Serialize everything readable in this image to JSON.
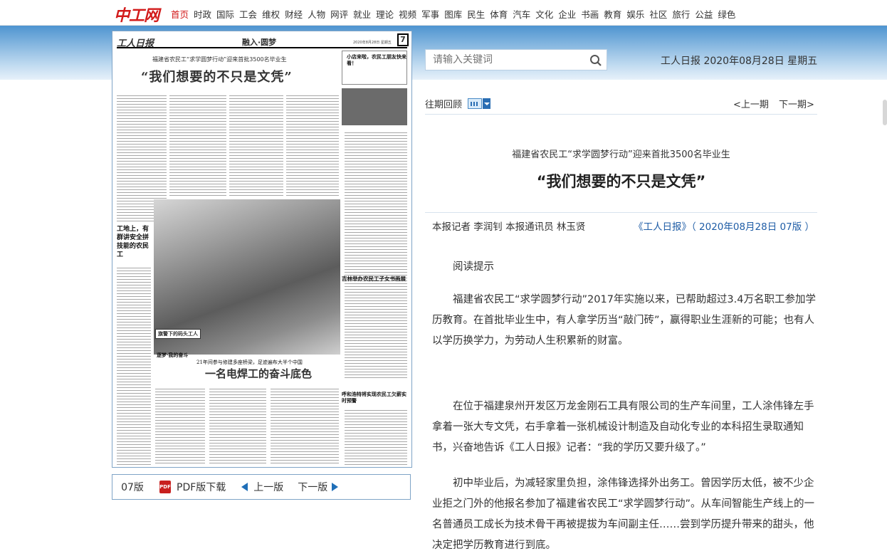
{
  "site": {
    "logo": "中工网",
    "nav": [
      "首页",
      "时政",
      "国际",
      "工会",
      "维权",
      "财经",
      "人物",
      "网评",
      "就业",
      "理论",
      "视频",
      "军事",
      "图库",
      "民生",
      "体育",
      "汽车",
      "文化",
      "企业",
      "书画",
      "教育",
      "娱乐",
      "社区",
      "旅行",
      "公益",
      "绿色"
    ],
    "active_nav": "首页"
  },
  "paper": {
    "logo": "工人日报",
    "section": "融入·圆梦",
    "page_no": "7",
    "date": "2020年8月28日 星期五",
    "subtitle": "福建省农民工“求学圆梦行动”迎来首批3500名毕业生",
    "headline": "“我们想要的不只是文凭”",
    "box_title": "小店来啦，农民工朋友快来看！",
    "side_head_1": "工地上，有群讲安全拼技能的农民工",
    "side_head_2": "吉林举办农民工子女书画展",
    "side_head_3": "呼和浩特将实现农民工欠薪实时预警",
    "photo_caption": "旗警下的码头工人",
    "lower_kicker": "21年间参与修建多座桥梁，足迹遍布大半个中国",
    "lower_headline": "一名电焊工的奋斗底色",
    "lower_tag": "逐梦·我的奋斗"
  },
  "pager": {
    "page_label": "07版",
    "pdf_label": "PDF版下载",
    "prev_label": "上一版",
    "next_label": "下一版"
  },
  "search": {
    "placeholder": "请输入关键词"
  },
  "header_date": "工人日报 2020年08月28日 星期五",
  "archive": {
    "label": "往期回顾",
    "prev": "<上一期",
    "next": "下一期>"
  },
  "article": {
    "subtitle": "福建省农民工“求学圆梦行动”迎来首批3500名毕业生",
    "title": "“我们想要的不只是文凭”",
    "byline": "本报记者 李润钊 本报通讯员 林玉贤",
    "source": "《工人日报》（ 2020年08月28日 07版 ）",
    "paragraphs": [
      "阅读提示",
      "福建省农民工“求学圆梦行动”2017年实施以来，已帮助超过3.4万名职工参加学历教育。在首批毕业生中，有人拿学历当“敲门砖”，赢得职业生涯新的可能；也有人以学历换学力，为劳动人生积累新的财富。",
      "在位于福建泉州开发区万龙金刚石工具有限公司的生产车间里，工人涂伟锋左手拿着一张大专文凭，右手拿着一张机械设计制造及自动化专业的本科招生录取通知书，兴奋地告诉《工人日报》记者：“我的学历又要升级了。”",
      "初中毕业后，为减轻家里负担，涂伟锋选择外出务工。曾因学历太低，被不少企业拒之门外的他报名参加了福建省农民工“求学圆梦行动”。从车间智能生产线上的一名普通员工成长为技术骨干再被提拔为车间副主任……尝到学历提升带来的甜头，他决定把学历教育进行到底。"
    ]
  }
}
